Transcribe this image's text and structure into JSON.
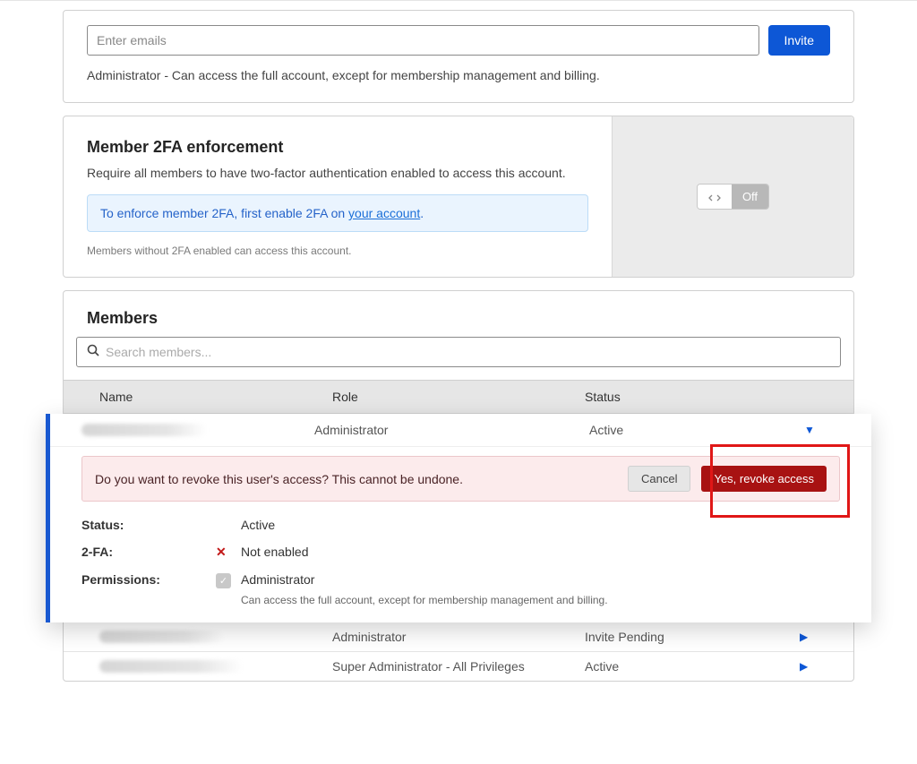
{
  "invite": {
    "placeholder": "Enter emails",
    "button": "Invite",
    "desc": "Administrator - Can access the full account, except for membership management and billing."
  },
  "twofa": {
    "title": "Member 2FA enforcement",
    "sub": "Require all members to have two-factor authentication enabled to access this account.",
    "callout_prefix": "To enforce member 2FA, first enable 2FA on ",
    "callout_link": "your account",
    "callout_suffix": ".",
    "helper": "Members without 2FA enabled can access this account.",
    "off_label": "Off"
  },
  "members": {
    "title": "Members",
    "search_placeholder": "Search members...",
    "columns": {
      "name": "Name",
      "role": "Role",
      "status": "Status"
    },
    "rows": [
      {
        "role": "Administrator",
        "status": "Active",
        "expanded": true
      },
      {
        "role": "Administrator",
        "status": "Invite Pending",
        "expanded": false
      },
      {
        "role": "Super Administrator - All Privileges",
        "status": "Active",
        "expanded": false
      }
    ]
  },
  "revoke": {
    "msg": "Do you want to revoke this user's access? This cannot be undone.",
    "cancel": "Cancel",
    "confirm": "Yes, revoke access"
  },
  "detail": {
    "status_label": "Status:",
    "status_value": "Active",
    "tfa_label": "2-FA:",
    "tfa_value": "Not enabled",
    "perm_label": "Permissions:",
    "perm_value": "Administrator",
    "perm_sub": "Can access the full account, except for membership management and billing."
  }
}
